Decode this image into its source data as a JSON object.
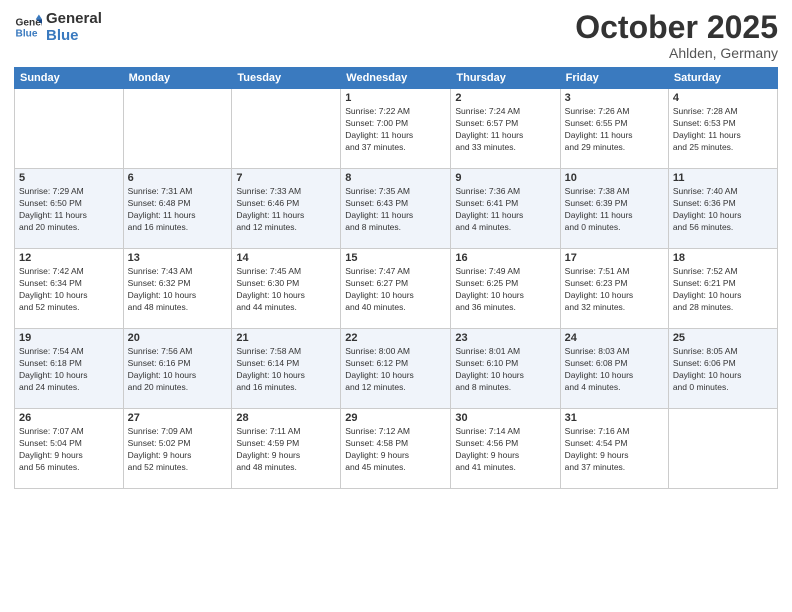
{
  "logo": {
    "line1": "General",
    "line2": "Blue"
  },
  "title": "October 2025",
  "location": "Ahlden, Germany",
  "days_of_week": [
    "Sunday",
    "Monday",
    "Tuesday",
    "Wednesday",
    "Thursday",
    "Friday",
    "Saturday"
  ],
  "weeks": [
    [
      {
        "day": "",
        "info": ""
      },
      {
        "day": "",
        "info": ""
      },
      {
        "day": "",
        "info": ""
      },
      {
        "day": "1",
        "info": "Sunrise: 7:22 AM\nSunset: 7:00 PM\nDaylight: 11 hours\nand 37 minutes."
      },
      {
        "day": "2",
        "info": "Sunrise: 7:24 AM\nSunset: 6:57 PM\nDaylight: 11 hours\nand 33 minutes."
      },
      {
        "day": "3",
        "info": "Sunrise: 7:26 AM\nSunset: 6:55 PM\nDaylight: 11 hours\nand 29 minutes."
      },
      {
        "day": "4",
        "info": "Sunrise: 7:28 AM\nSunset: 6:53 PM\nDaylight: 11 hours\nand 25 minutes."
      }
    ],
    [
      {
        "day": "5",
        "info": "Sunrise: 7:29 AM\nSunset: 6:50 PM\nDaylight: 11 hours\nand 20 minutes."
      },
      {
        "day": "6",
        "info": "Sunrise: 7:31 AM\nSunset: 6:48 PM\nDaylight: 11 hours\nand 16 minutes."
      },
      {
        "day": "7",
        "info": "Sunrise: 7:33 AM\nSunset: 6:46 PM\nDaylight: 11 hours\nand 12 minutes."
      },
      {
        "day": "8",
        "info": "Sunrise: 7:35 AM\nSunset: 6:43 PM\nDaylight: 11 hours\nand 8 minutes."
      },
      {
        "day": "9",
        "info": "Sunrise: 7:36 AM\nSunset: 6:41 PM\nDaylight: 11 hours\nand 4 minutes."
      },
      {
        "day": "10",
        "info": "Sunrise: 7:38 AM\nSunset: 6:39 PM\nDaylight: 11 hours\nand 0 minutes."
      },
      {
        "day": "11",
        "info": "Sunrise: 7:40 AM\nSunset: 6:36 PM\nDaylight: 10 hours\nand 56 minutes."
      }
    ],
    [
      {
        "day": "12",
        "info": "Sunrise: 7:42 AM\nSunset: 6:34 PM\nDaylight: 10 hours\nand 52 minutes."
      },
      {
        "day": "13",
        "info": "Sunrise: 7:43 AM\nSunset: 6:32 PM\nDaylight: 10 hours\nand 48 minutes."
      },
      {
        "day": "14",
        "info": "Sunrise: 7:45 AM\nSunset: 6:30 PM\nDaylight: 10 hours\nand 44 minutes."
      },
      {
        "day": "15",
        "info": "Sunrise: 7:47 AM\nSunset: 6:27 PM\nDaylight: 10 hours\nand 40 minutes."
      },
      {
        "day": "16",
        "info": "Sunrise: 7:49 AM\nSunset: 6:25 PM\nDaylight: 10 hours\nand 36 minutes."
      },
      {
        "day": "17",
        "info": "Sunrise: 7:51 AM\nSunset: 6:23 PM\nDaylight: 10 hours\nand 32 minutes."
      },
      {
        "day": "18",
        "info": "Sunrise: 7:52 AM\nSunset: 6:21 PM\nDaylight: 10 hours\nand 28 minutes."
      }
    ],
    [
      {
        "day": "19",
        "info": "Sunrise: 7:54 AM\nSunset: 6:18 PM\nDaylight: 10 hours\nand 24 minutes."
      },
      {
        "day": "20",
        "info": "Sunrise: 7:56 AM\nSunset: 6:16 PM\nDaylight: 10 hours\nand 20 minutes."
      },
      {
        "day": "21",
        "info": "Sunrise: 7:58 AM\nSunset: 6:14 PM\nDaylight: 10 hours\nand 16 minutes."
      },
      {
        "day": "22",
        "info": "Sunrise: 8:00 AM\nSunset: 6:12 PM\nDaylight: 10 hours\nand 12 minutes."
      },
      {
        "day": "23",
        "info": "Sunrise: 8:01 AM\nSunset: 6:10 PM\nDaylight: 10 hours\nand 8 minutes."
      },
      {
        "day": "24",
        "info": "Sunrise: 8:03 AM\nSunset: 6:08 PM\nDaylight: 10 hours\nand 4 minutes."
      },
      {
        "day": "25",
        "info": "Sunrise: 8:05 AM\nSunset: 6:06 PM\nDaylight: 10 hours\nand 0 minutes."
      }
    ],
    [
      {
        "day": "26",
        "info": "Sunrise: 7:07 AM\nSunset: 5:04 PM\nDaylight: 9 hours\nand 56 minutes."
      },
      {
        "day": "27",
        "info": "Sunrise: 7:09 AM\nSunset: 5:02 PM\nDaylight: 9 hours\nand 52 minutes."
      },
      {
        "day": "28",
        "info": "Sunrise: 7:11 AM\nSunset: 4:59 PM\nDaylight: 9 hours\nand 48 minutes."
      },
      {
        "day": "29",
        "info": "Sunrise: 7:12 AM\nSunset: 4:58 PM\nDaylight: 9 hours\nand 45 minutes."
      },
      {
        "day": "30",
        "info": "Sunrise: 7:14 AM\nSunset: 4:56 PM\nDaylight: 9 hours\nand 41 minutes."
      },
      {
        "day": "31",
        "info": "Sunrise: 7:16 AM\nSunset: 4:54 PM\nDaylight: 9 hours\nand 37 minutes."
      },
      {
        "day": "",
        "info": ""
      }
    ]
  ]
}
